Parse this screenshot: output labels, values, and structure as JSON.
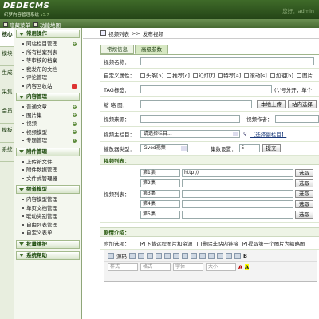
{
  "header": {
    "logo": "DEDECMS",
    "subtitle": "织梦内容管理系统",
    "version": "v5.7",
    "welcome": "您好：admin"
  },
  "topbar": {
    "hide_menu": "隐藏菜单",
    "home": "功能地图"
  },
  "vtabs": [
    "核心",
    "模块",
    "生成",
    "采集",
    "会员",
    "模板",
    "系统"
  ],
  "sidebar": {
    "groups": [
      {
        "title": "常用操作",
        "items": [
          "网站栏目管理",
          "所有档案列表",
          "等审核的档案",
          "我发布的文档",
          "评论管理",
          "内容回收站"
        ]
      },
      {
        "title": "内容管理",
        "items": [
          "普通文章",
          "图片集",
          "视频",
          "视频模型",
          "专题管理"
        ]
      },
      {
        "title": "附件管理",
        "items": [
          "上传新文件",
          "附件数据管理",
          "文件式管理器"
        ]
      },
      {
        "title": "频道模型",
        "items": [
          "内容模型管理",
          "单页文档管理",
          "联动类别管理",
          "自由列表管理",
          "自定义表单"
        ]
      },
      {
        "title": "批量维护",
        "items": []
      },
      {
        "title": "系统帮助",
        "items": []
      }
    ]
  },
  "breadcrumb": {
    "list": "视频列表",
    "sep": ">>",
    "current": "发布视频"
  },
  "tabs": [
    "常规信息",
    "高级参数"
  ],
  "form": {
    "title_label": "视频名称：",
    "attr_label": "自定义属性：",
    "attrs": [
      "头条[h]",
      "推荐[c]",
      "幻灯[f]",
      "特荐[a]",
      "滚动[s]",
      "加粗[b]",
      "图片"
    ],
    "tag_label": "TAG标签：",
    "tag_hint": "(','号分开，单个",
    "thumb_label": "缩 略 图：",
    "upload_btn": "本地上传",
    "station_btn": "站内选择",
    "source_label": "视频来源：",
    "author_label": "视频作者：",
    "column_label": "视频主栏目：",
    "column_select": "请选择栏目...",
    "column_sub": "【选择副栏目】",
    "player_label": "播放器类型：",
    "player_value": "Gvod视频",
    "episodes_label": "集数设置：",
    "episodes_value": "5",
    "submit_btn": "提交",
    "list_section": "视频列表：",
    "list_label": "视频列表：",
    "episodes": [
      {
        "name": "第1集",
        "url": "http://"
      },
      {
        "name": "第2集",
        "url": ""
      },
      {
        "name": "第3集",
        "url": ""
      },
      {
        "name": "第4集",
        "url": ""
      },
      {
        "name": "第5集",
        "url": ""
      }
    ],
    "choose_btn": "选取",
    "intro_section": "剧情介绍：",
    "extra_label": "附加选项：",
    "extra_opts": [
      "下载远程图片和资源",
      "删除非站内链接",
      "提取第一个图片为缩略图"
    ],
    "source_btn": "源码",
    "style_sel": "样式",
    "format_sel": "格式",
    "font_sel": "字体",
    "size_sel": "大小"
  },
  "colors": {
    "accent": "#3f6b29",
    "bar": "#476a32"
  }
}
